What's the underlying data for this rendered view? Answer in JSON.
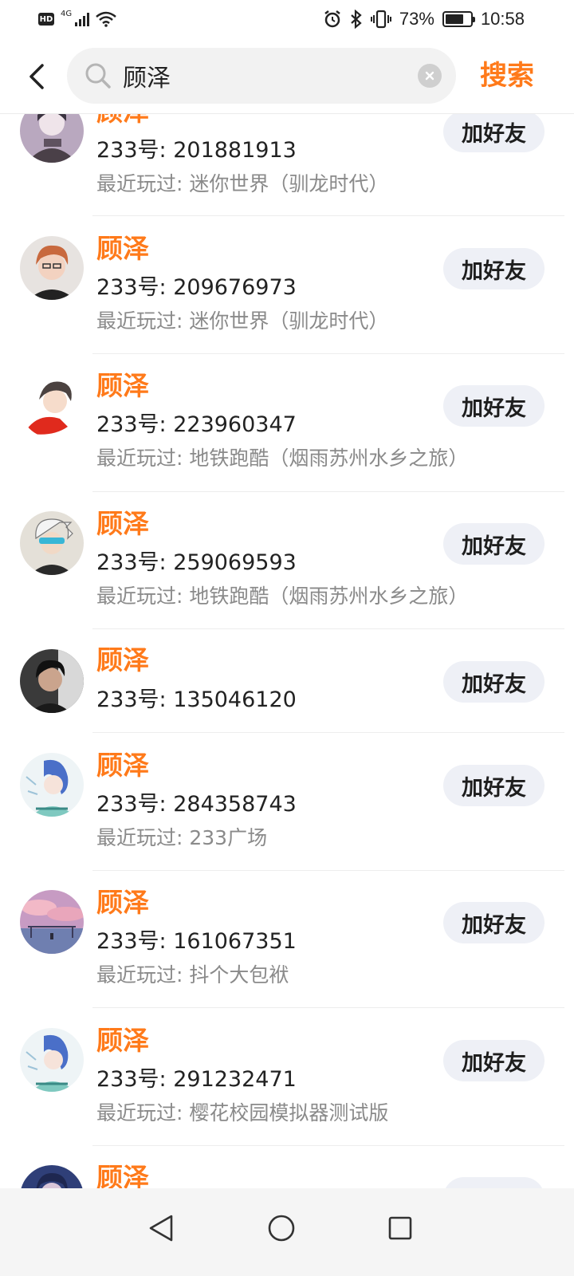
{
  "status_bar": {
    "hd": "HD",
    "network": "4G",
    "battery_percent": "73%",
    "battery_level": 0.73,
    "time": "10:58"
  },
  "search": {
    "query": "顾泽",
    "submit_label": "搜索"
  },
  "add_friend_label": "加好友",
  "results": [
    {
      "name": "顾泽",
      "id": "233号: 201881913",
      "recent": "最近玩过: 迷你世界（驯龙时代）"
    },
    {
      "name": "顾泽",
      "id": "233号: 209676973",
      "recent": "最近玩过: 迷你世界（驯龙时代）"
    },
    {
      "name": "顾泽",
      "id": "233号: 223960347",
      "recent": "最近玩过: 地铁跑酷（烟雨苏州水乡之旅）"
    },
    {
      "name": "顾泽",
      "id": "233号: 259069593",
      "recent": "最近玩过: 地铁跑酷（烟雨苏州水乡之旅）"
    },
    {
      "name": "顾泽",
      "id": "233号: 135046120",
      "recent": ""
    },
    {
      "name": "顾泽",
      "id": "233号: 284358743",
      "recent": "最近玩过: 233广场"
    },
    {
      "name": "顾泽",
      "id": "233号: 161067351",
      "recent": "最近玩过: 抖个大包袱"
    },
    {
      "name": "顾泽",
      "id": "233号: 291232471",
      "recent": "最近玩过: 樱花校园模拟器测试版"
    },
    {
      "name": "顾泽",
      "id": "",
      "recent": ""
    }
  ],
  "colors": {
    "accent": "#ff7a1a",
    "button_bg": "#eef0f6",
    "secondary_text": "#8a8a8a"
  }
}
